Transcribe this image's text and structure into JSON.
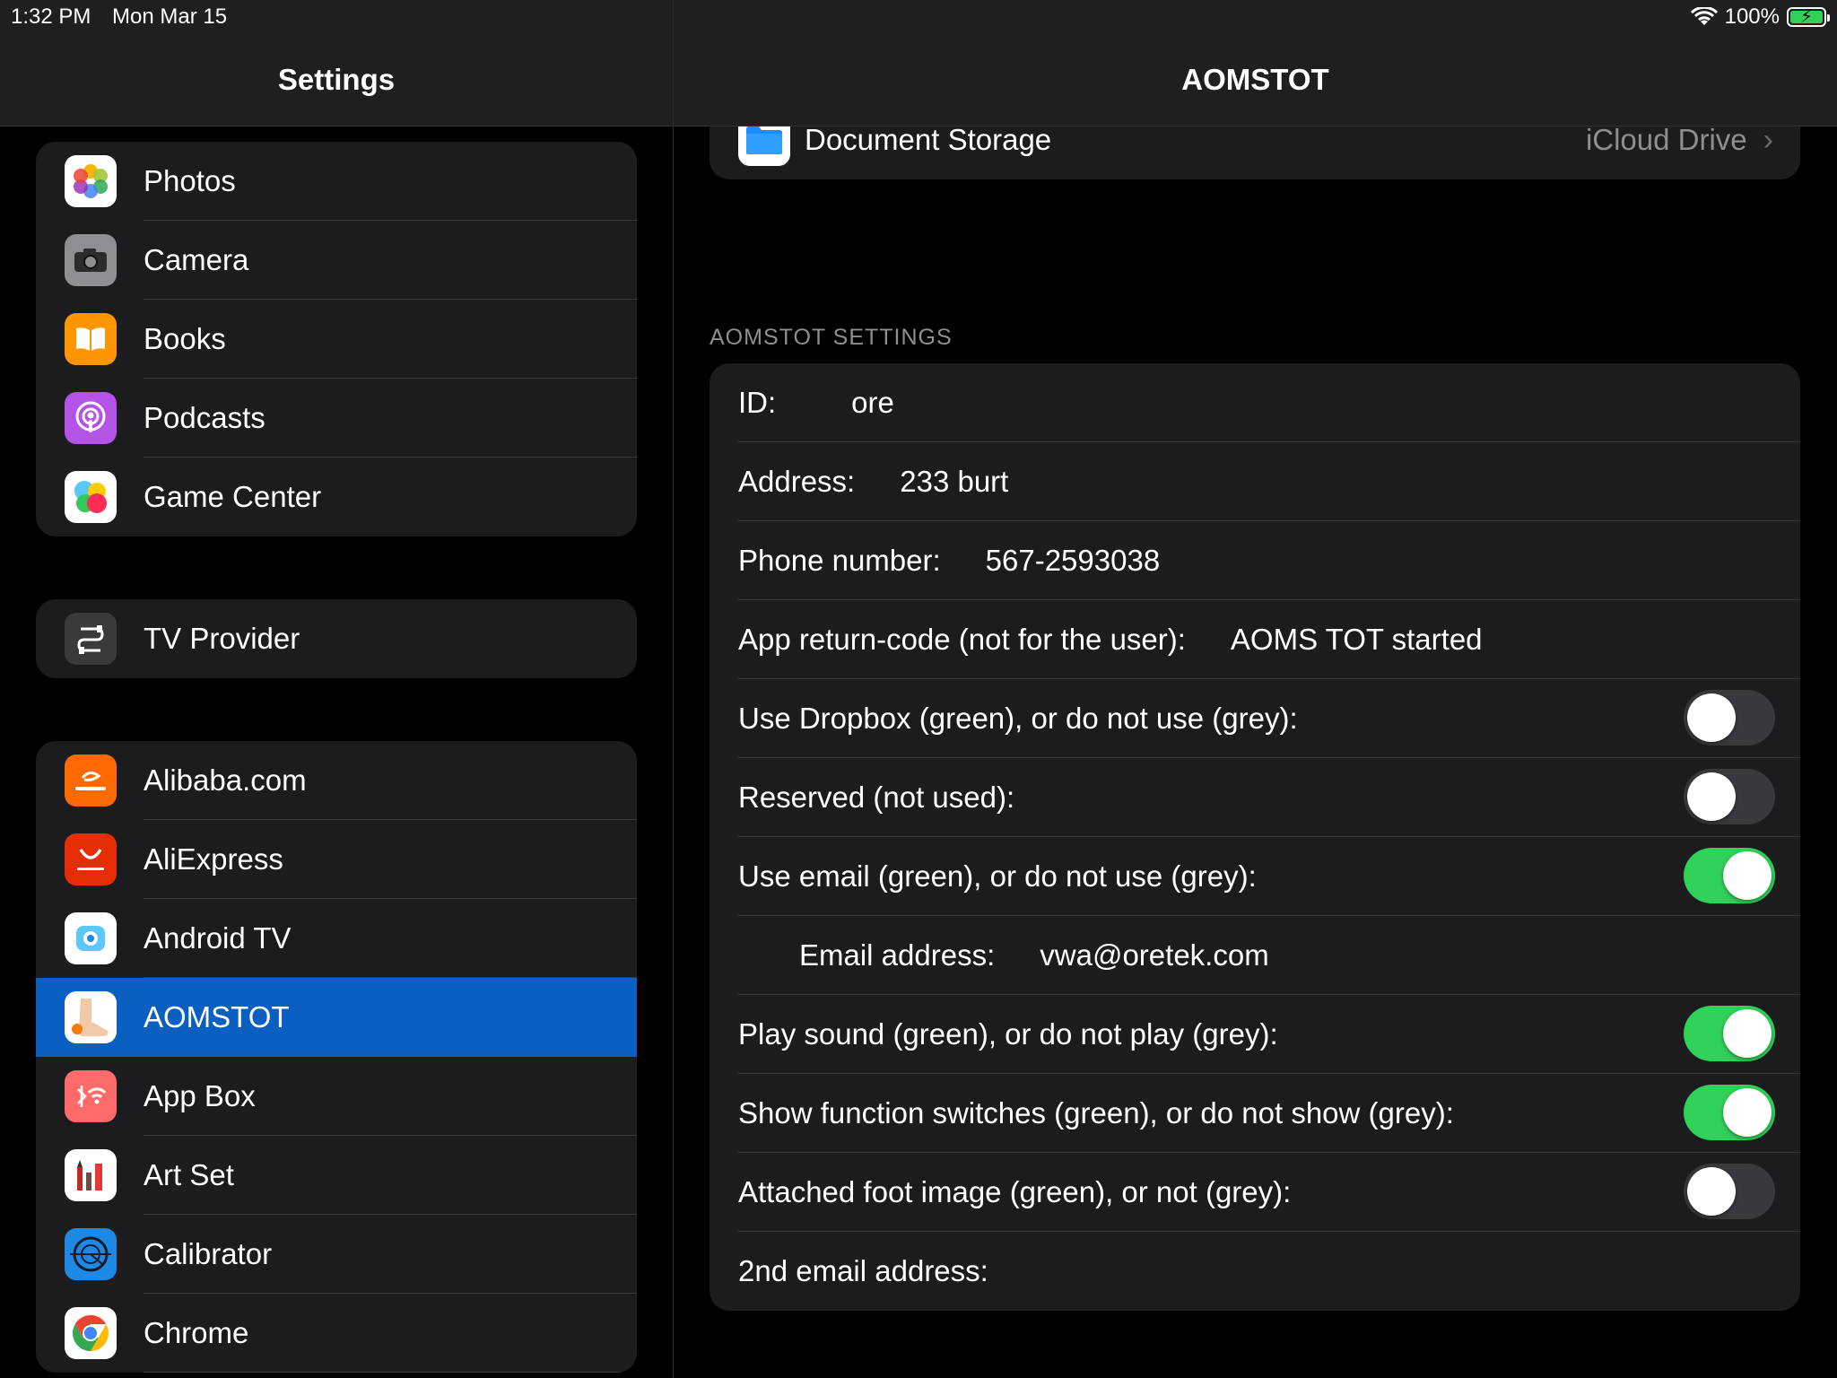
{
  "status": {
    "time": "1:32 PM",
    "date": "Mon Mar 15",
    "battery": "100%"
  },
  "sidebar": {
    "title": "Settings",
    "group1": [
      {
        "label": "Photos",
        "icon": "photos-icon"
      },
      {
        "label": "Camera",
        "icon": "camera-icon"
      },
      {
        "label": "Books",
        "icon": "books-icon"
      },
      {
        "label": "Podcasts",
        "icon": "podcasts-icon"
      },
      {
        "label": "Game Center",
        "icon": "game-center-icon"
      }
    ],
    "group2": [
      {
        "label": "TV Provider",
        "icon": "tv-provider-icon"
      }
    ],
    "group3": [
      {
        "label": "Alibaba.com",
        "icon": "alibaba-icon"
      },
      {
        "label": "AliExpress",
        "icon": "aliexpress-icon"
      },
      {
        "label": "Android TV",
        "icon": "android-tv-icon"
      },
      {
        "label": "AOMSTOT",
        "icon": "aomstot-icon",
        "selected": true
      },
      {
        "label": "App Box",
        "icon": "app-box-icon"
      },
      {
        "label": "Art Set",
        "icon": "art-set-icon"
      },
      {
        "label": "Calibrator",
        "icon": "calibrator-icon"
      },
      {
        "label": "Chrome",
        "icon": "chrome-icon"
      }
    ]
  },
  "detail": {
    "title": "AOMSTOT",
    "document_storage": {
      "label": "Document Storage",
      "value": "iCloud Drive"
    },
    "section_header": "AOMSTOT SETTINGS",
    "id": {
      "label": "ID:",
      "value": "ore"
    },
    "address": {
      "label": "Address:",
      "value": "233 burt"
    },
    "phone": {
      "label": "Phone number:",
      "value": "567-2593038"
    },
    "return_code": {
      "label": "App return-code (not for the user):",
      "value": "AOMS TOT started"
    },
    "dropbox": {
      "label": "Use Dropbox (green), or do not use (grey):",
      "on": false
    },
    "reserved": {
      "label": "Reserved (not used):",
      "on": false
    },
    "use_email": {
      "label": "Use email (green), or do not use (grey):",
      "on": true
    },
    "email_address": {
      "label": "Email address:",
      "value": "vwa@oretek.com"
    },
    "play_sound": {
      "label": "Play sound (green), or do not play (grey):",
      "on": true
    },
    "show_switches": {
      "label": "Show function switches (green), or do not show (grey):",
      "on": true
    },
    "foot_image": {
      "label": "Attached foot image (green), or not (grey):",
      "on": false
    },
    "second_email": {
      "label": "2nd email address:"
    }
  },
  "colors": {
    "accent": "#0a5fc0",
    "toggle_on": "#30d158",
    "toggle_off": "#39393d"
  }
}
